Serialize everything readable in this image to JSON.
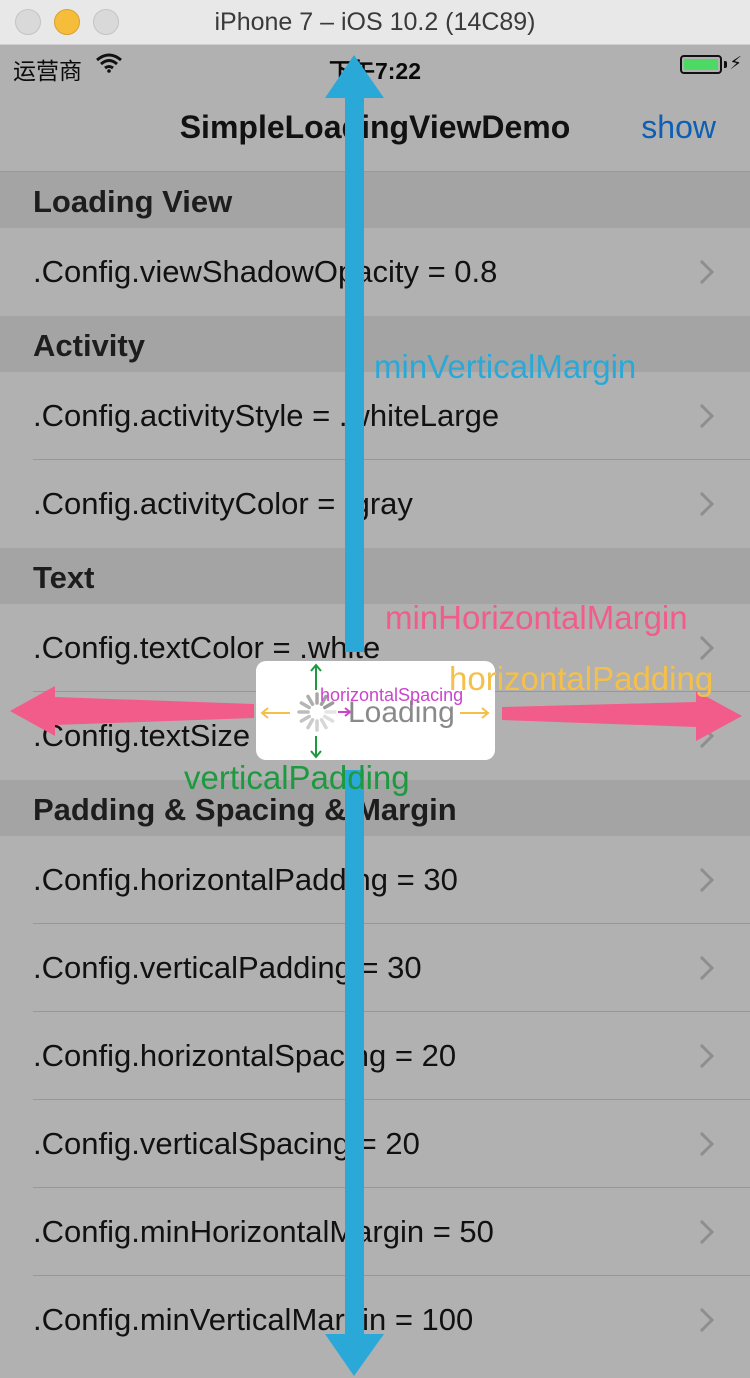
{
  "window": {
    "title": "iPhone 7 – iOS 10.2 (14C89)"
  },
  "statusbar": {
    "carrier": "运营商",
    "time": "下午7:22"
  },
  "navbar": {
    "title": "SimpleLoadingViewDemo",
    "right_button": "show"
  },
  "sections": [
    {
      "header": "Loading View",
      "rows": [
        ".Config.viewShadowOpacity = 0.8"
      ]
    },
    {
      "header": "Activity",
      "rows": [
        ".Config.activityStyle = .whiteLarge",
        ".Config.activityColor = .gray"
      ]
    },
    {
      "header": "Text",
      "rows": [
        ".Config.textColor = .white",
        ".Config.textSize = 15"
      ]
    },
    {
      "header": "Padding & Spacing & Margin",
      "rows": [
        ".Config.horizontalPadding = 30",
        ".Config.verticalPadding = 30",
        ".Config.horizontalSpacing = 20",
        ".Config.verticalSpacing = 20",
        ".Config.minHorizontalMargin = 50",
        ".Config.minVerticalMargin = 100"
      ]
    }
  ],
  "loading_hud": {
    "text": "Loading"
  },
  "annotations": {
    "min_vertical_margin": "minVerticalMargin",
    "min_horizontal_margin": "minHorizontalMargin",
    "horizontal_padding": "horizontalPadding",
    "vertical_padding": "verticalPadding",
    "horizontal_spacing": "horizontalSpacing"
  },
  "colors": {
    "min_vertical_margin": "#2aa9d8",
    "min_horizontal_margin": "#f25c8a",
    "horizontal_padding": "#f5c04a",
    "vertical_padding": "#1d9a40",
    "horizontal_spacing": "#cc44cc",
    "tint": "#0e5fb3"
  },
  "icons": [
    "close-button",
    "minimize-button",
    "zoom-button",
    "wifi-icon",
    "battery-icon",
    "chevron-right-icon",
    "activity-spinner-icon"
  ]
}
